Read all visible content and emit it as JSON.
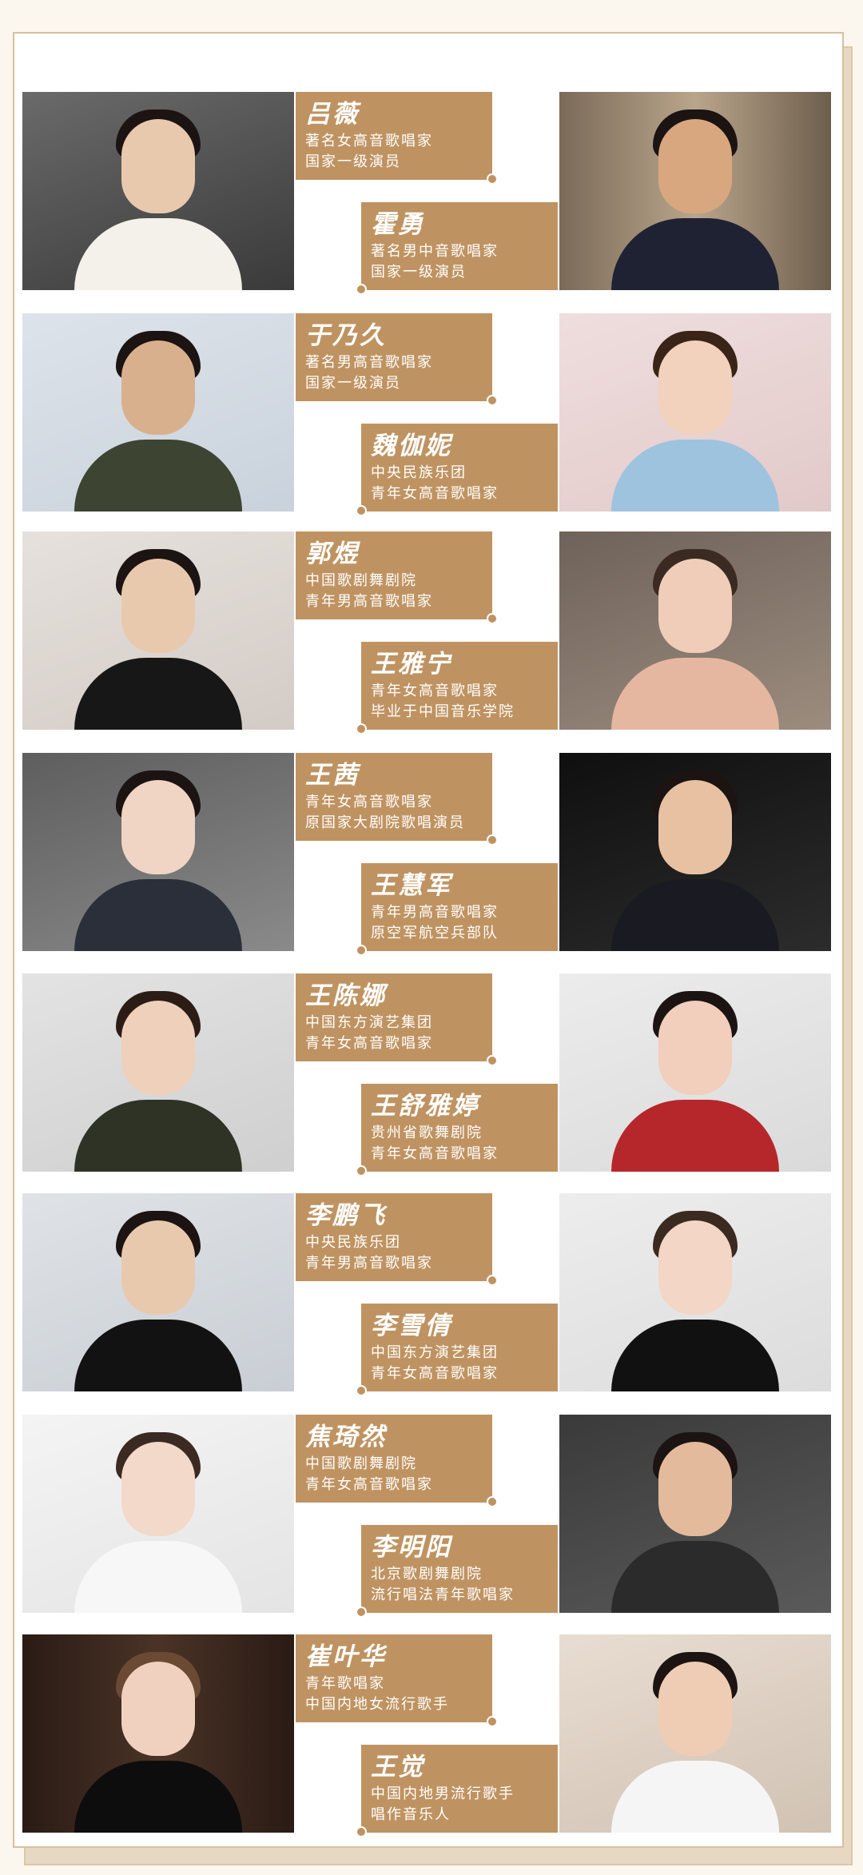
{
  "rows": [
    {
      "left": {
        "name": "吕薇",
        "lines": [
          "著名女高音歌唱家",
          "国家一级演员"
        ]
      },
      "right": {
        "name": "霍勇",
        "lines": [
          "著名男中音歌唱家",
          "国家一级演员"
        ]
      }
    },
    {
      "left": {
        "name": "于乃久",
        "lines": [
          "著名男高音歌唱家",
          "国家一级演员"
        ]
      },
      "right": {
        "name": "魏伽妮",
        "lines": [
          "中央民族乐团",
          "青年女高音歌唱家"
        ]
      }
    },
    {
      "left": {
        "name": "郭煜",
        "lines": [
          "中国歌剧舞剧院",
          "青年男高音歌唱家"
        ]
      },
      "right": {
        "name": "王雅宁",
        "lines": [
          "青年女高音歌唱家",
          "毕业于中国音乐学院"
        ]
      }
    },
    {
      "left": {
        "name": "王茜",
        "lines": [
          "青年女高音歌唱家",
          "原国家大剧院歌唱演员"
        ]
      },
      "right": {
        "name": "王慧军",
        "lines": [
          "青年男高音歌唱家",
          "原空军航空兵部队"
        ]
      }
    },
    {
      "left": {
        "name": "王陈娜",
        "lines": [
          "中国东方演艺集团",
          "青年女高音歌唱家"
        ]
      },
      "right": {
        "name": "王舒雅婷",
        "lines": [
          "贵州省歌舞剧院",
          "青年女高音歌唱家"
        ]
      }
    },
    {
      "left": {
        "name": "李鹏飞",
        "lines": [
          "中央民族乐团",
          "青年男高音歌唱家"
        ]
      },
      "right": {
        "name": "李雪倩",
        "lines": [
          "中国东方演艺集团",
          "青年女高音歌唱家"
        ]
      }
    },
    {
      "left": {
        "name": "焦琦然",
        "lines": [
          "中国歌剧舞剧院",
          "青年女高音歌唱家"
        ]
      },
      "right": {
        "name": "李明阳",
        "lines": [
          "北京歌剧舞剧院",
          "流行唱法青年歌唱家"
        ]
      }
    },
    {
      "left": {
        "name": "崔叶华",
        "lines": [
          "青年歌唱家",
          "中国内地女流行歌手"
        ]
      },
      "right": {
        "name": "王觉",
        "lines": [
          "中国内地男流行歌手",
          "唱作音乐人"
        ]
      }
    }
  ]
}
